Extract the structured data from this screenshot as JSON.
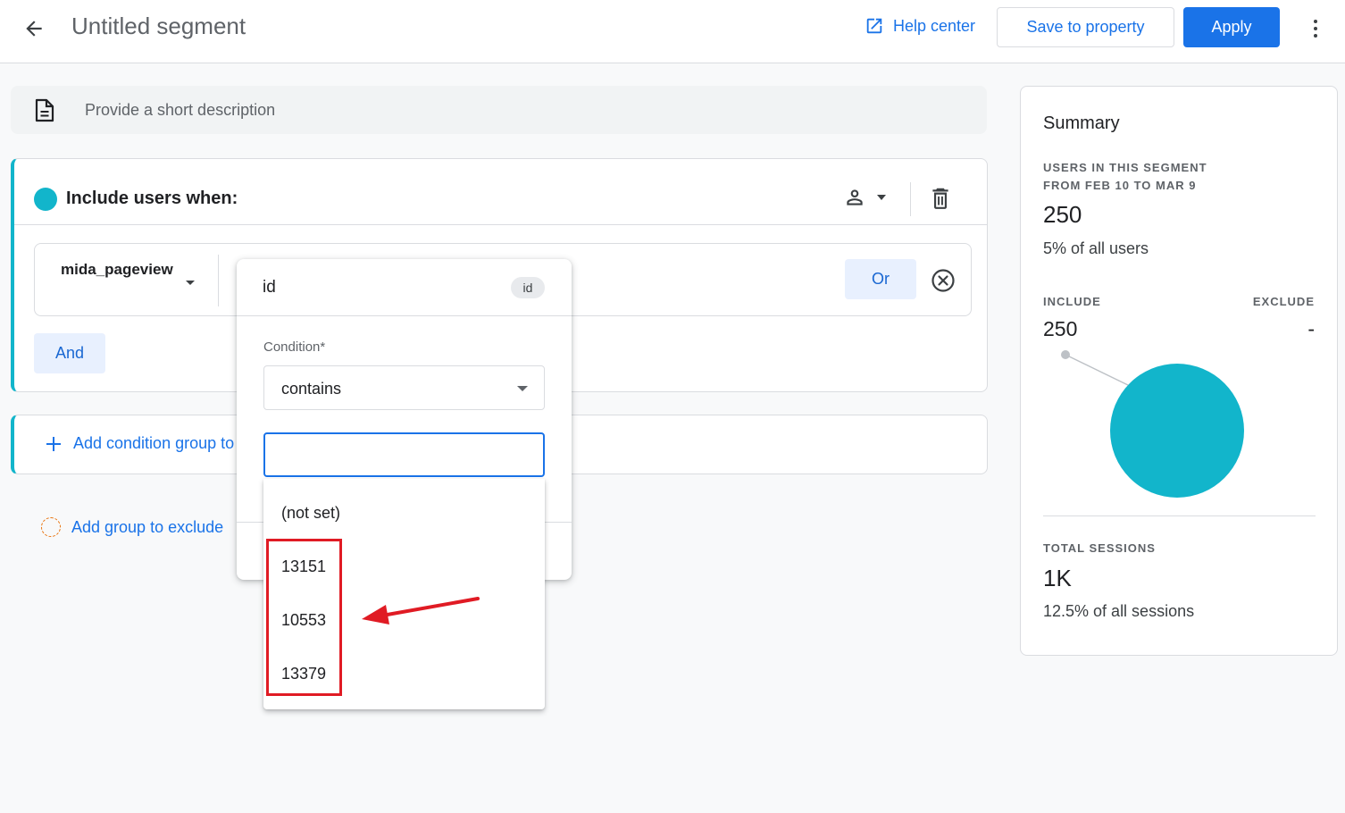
{
  "header": {
    "title": "Untitled segment",
    "help_center": "Help center",
    "save_to_property": "Save to property",
    "apply": "Apply"
  },
  "description": {
    "placeholder": "Provide a short description"
  },
  "include_group": {
    "title": "Include users when:",
    "event_name": "mida_pageview",
    "or_label": "Or",
    "and_label": "And"
  },
  "add_condition_group": {
    "label": "Add condition group to include"
  },
  "exclude": {
    "label": "Add group to exclude"
  },
  "popup": {
    "title": "id",
    "chip": "id",
    "condition_label": "Condition*",
    "condition_value": "contains",
    "value_input": ""
  },
  "suggestions": [
    "(not set)",
    "13151",
    "10553",
    "13379"
  ],
  "summary": {
    "title": "Summary",
    "users_caption_line1": "USERS IN THIS SEGMENT",
    "users_caption_line2": "FROM FEB 10 TO MAR 9",
    "users_count": "250",
    "users_percent": "5% of all users",
    "include_label": "INCLUDE",
    "exclude_label": "EXCLUDE",
    "include_value": "250",
    "exclude_value": "-",
    "sessions_caption": "TOTAL SESSIONS",
    "sessions_count": "1K",
    "sessions_percent": "12.5% of all sessions"
  },
  "colors": {
    "accent": "#1a73e8",
    "segment": "#12b5cb",
    "annotation": "#e01b24"
  }
}
